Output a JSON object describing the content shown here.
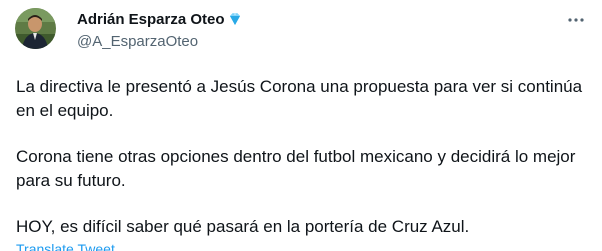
{
  "author": {
    "display_name": "Adrián Esparza Oteo",
    "handle": "@A_EsparzaOteo",
    "verified_icon": "diamond-icon"
  },
  "tweet": {
    "paragraphs": [
      "La directiva le presentó a Jesús Corona una propuesta para ver si continúa en el equipo.",
      "Corona tiene otras opciones dentro del futbol mexicano y decidirá lo mejor para su futuro.",
      "HOY, es difícil saber qué pasará en la portería de Cruz Azul."
    ],
    "translate_label": "Translate Tweet"
  },
  "icons": {
    "more": "more-horizontal-icon"
  },
  "colors": {
    "text_primary": "#0f1419",
    "text_secondary": "#536471",
    "link": "#1d9bf0",
    "verified": "#4fc3f7"
  }
}
